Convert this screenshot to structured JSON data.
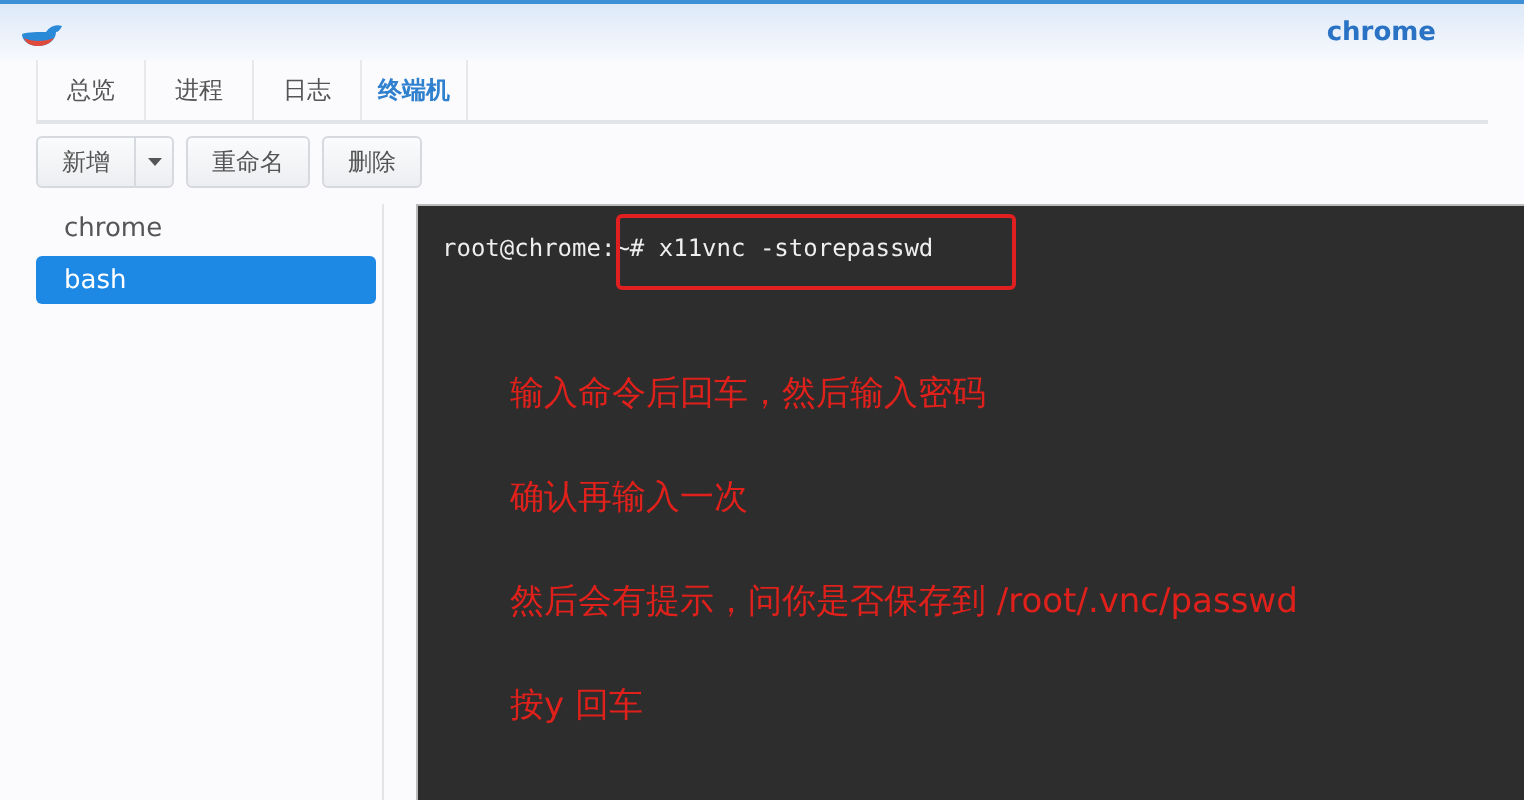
{
  "window": {
    "title": "chrome"
  },
  "tabs": [
    {
      "label": "总览",
      "selected": false
    },
    {
      "label": "进程",
      "selected": false
    },
    {
      "label": "日志",
      "selected": false
    },
    {
      "label": "终端机",
      "selected": true
    }
  ],
  "toolbar": {
    "new_button": "新增",
    "buttons": [
      "重命名",
      "删除"
    ]
  },
  "sidebar": {
    "items": [
      {
        "label": "chrome",
        "selected": false
      },
      {
        "label": "bash",
        "selected": true
      }
    ]
  },
  "terminal": {
    "prompt": "root@chrome:~#",
    "command": "x11vnc -storepasswd",
    "command_highlighted": true,
    "annotations": [
      "输入命令后回车，然后输入密码",
      "确认再输入一次",
      "然后会有提示，问你是否保存到 /root/.vnc/passwd",
      "按y 回车"
    ]
  }
}
